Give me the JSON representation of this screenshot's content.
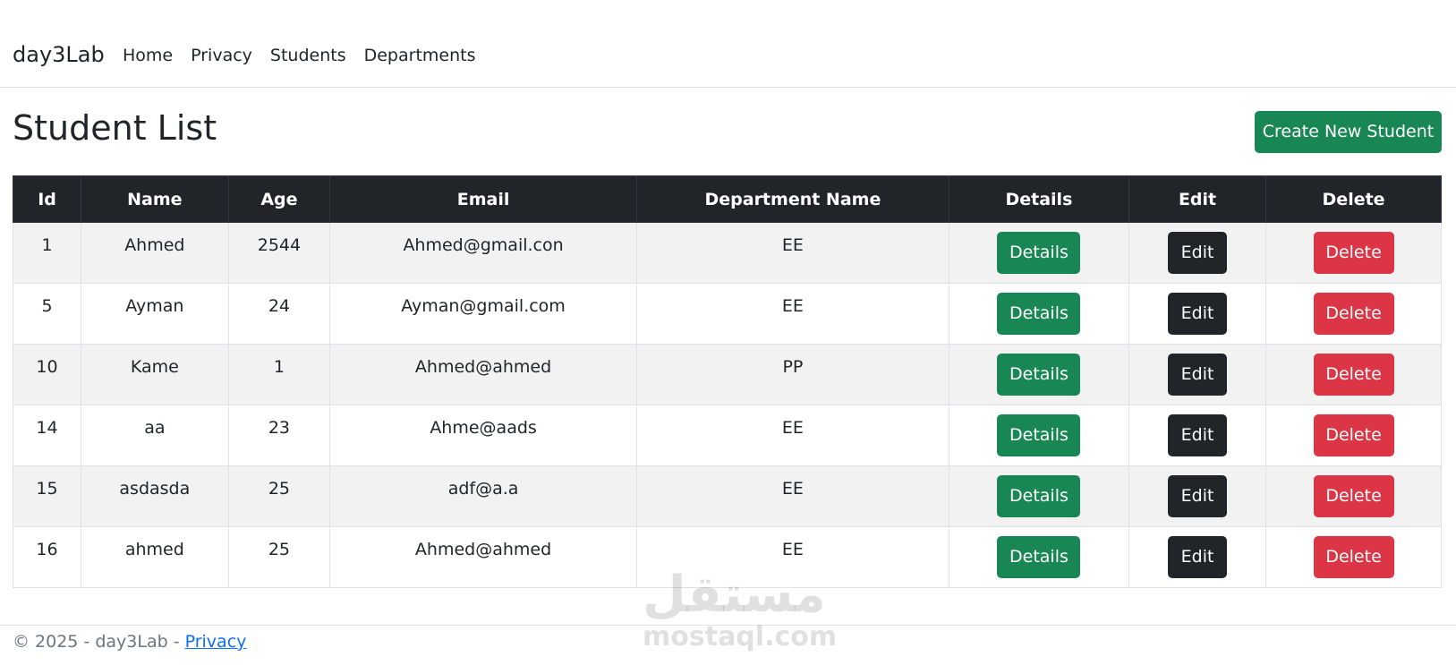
{
  "navbar": {
    "brand": "day3Lab",
    "links": [
      "Home",
      "Privacy",
      "Students",
      "Departments"
    ]
  },
  "main": {
    "title": "Student List",
    "create_button": "Create New Student"
  },
  "table": {
    "headers": [
      "Id",
      "Name",
      "Age",
      "Email",
      "Department Name",
      "Details",
      "Edit",
      "Delete"
    ],
    "rows": [
      {
        "id": "1",
        "name": "Ahmed",
        "age": "2544",
        "email": "Ahmed@gmail.con",
        "department": "EE"
      },
      {
        "id": "5",
        "name": "Ayman",
        "age": "24",
        "email": "Ayman@gmail.com",
        "department": "EE"
      },
      {
        "id": "10",
        "name": "Kame",
        "age": "1",
        "email": "Ahmed@ahmed",
        "department": "PP"
      },
      {
        "id": "14",
        "name": "aa",
        "age": "23",
        "email": "Ahme@aads",
        "department": "EE"
      },
      {
        "id": "15",
        "name": "asdasda",
        "age": "25",
        "email": "adf@a.a",
        "department": "EE"
      },
      {
        "id": "16",
        "name": "ahmed",
        "age": "25",
        "email": "Ahmed@ahmed",
        "department": "EE"
      }
    ],
    "details_label": "Details",
    "edit_label": "Edit",
    "delete_label": "Delete"
  },
  "footer": {
    "text": "© 2025 - day3Lab - ",
    "privacy_link": "Privacy"
  },
  "watermark": {
    "arabic": "مستقل",
    "latin": "mostaql.com"
  },
  "colors": {
    "success": "#198754",
    "dark": "#212529",
    "danger": "#dc3545",
    "link": "#0d6efd"
  }
}
